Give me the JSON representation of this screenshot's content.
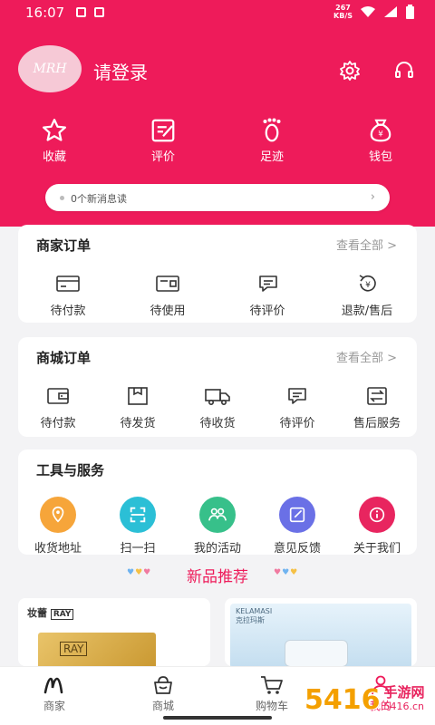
{
  "status": {
    "time": "16:07",
    "speed_value": "267",
    "speed_unit": "KB/S"
  },
  "user": {
    "avatar_text": "MRH",
    "login": "请登录"
  },
  "quick": [
    {
      "label": "收藏",
      "icon": "star-icon"
    },
    {
      "label": "评价",
      "icon": "edit-icon"
    },
    {
      "label": "足迹",
      "icon": "footprint-icon"
    },
    {
      "label": "钱包",
      "icon": "wallet-icon"
    }
  ],
  "message": {
    "text": "0个新消息读"
  },
  "merchant_orders": {
    "title": "商家订单",
    "more": "查看全部 >",
    "items": [
      {
        "label": "待付款",
        "icon": "card-icon"
      },
      {
        "label": "待使用",
        "icon": "ticket-icon"
      },
      {
        "label": "待评价",
        "icon": "comment-icon"
      },
      {
        "label": "退款/售后",
        "icon": "refund-icon"
      }
    ]
  },
  "mall_orders": {
    "title": "商城订单",
    "more": "查看全部 >",
    "items": [
      {
        "label": "待付款",
        "icon": "wallet-icon"
      },
      {
        "label": "待发货",
        "icon": "box-icon"
      },
      {
        "label": "待收货",
        "icon": "truck-icon"
      },
      {
        "label": "待评价",
        "icon": "comment-icon"
      },
      {
        "label": "售后服务",
        "icon": "exchange-icon"
      }
    ]
  },
  "tools": {
    "title": "工具与服务",
    "items": [
      {
        "label": "收货地址",
        "icon": "location-icon",
        "color": "#f6a53a"
      },
      {
        "label": "扫一扫",
        "icon": "scan-icon",
        "color": "#2bbfd6"
      },
      {
        "label": "我的活动",
        "icon": "people-icon",
        "color": "#37c08a"
      },
      {
        "label": "意见反馈",
        "icon": "feedback-icon",
        "color": "#6a70e6"
      },
      {
        "label": "关于我们",
        "icon": "info-icon",
        "color": "#e8255f"
      }
    ]
  },
  "new_products": {
    "title": "新品推荐",
    "brand_left": "妆蕾",
    "brand_left_sub": "RAY",
    "box_text": "RAY",
    "brand_right": "KELAMASI",
    "brand_right_sub": "克拉玛斯"
  },
  "tabbar": [
    {
      "label": "商家",
      "icon": "m-logo-icon"
    },
    {
      "label": "商城",
      "icon": "shop-bag-icon"
    },
    {
      "label": "购物车",
      "icon": "cart-icon"
    },
    {
      "label": "我的",
      "icon": "user-icon"
    }
  ],
  "watermark": {
    "text": "5416",
    "site": "手游网",
    "domain": "5416.cn"
  },
  "colors": {
    "brand": "#ee1b5a",
    "background": "#f3f3f5"
  }
}
